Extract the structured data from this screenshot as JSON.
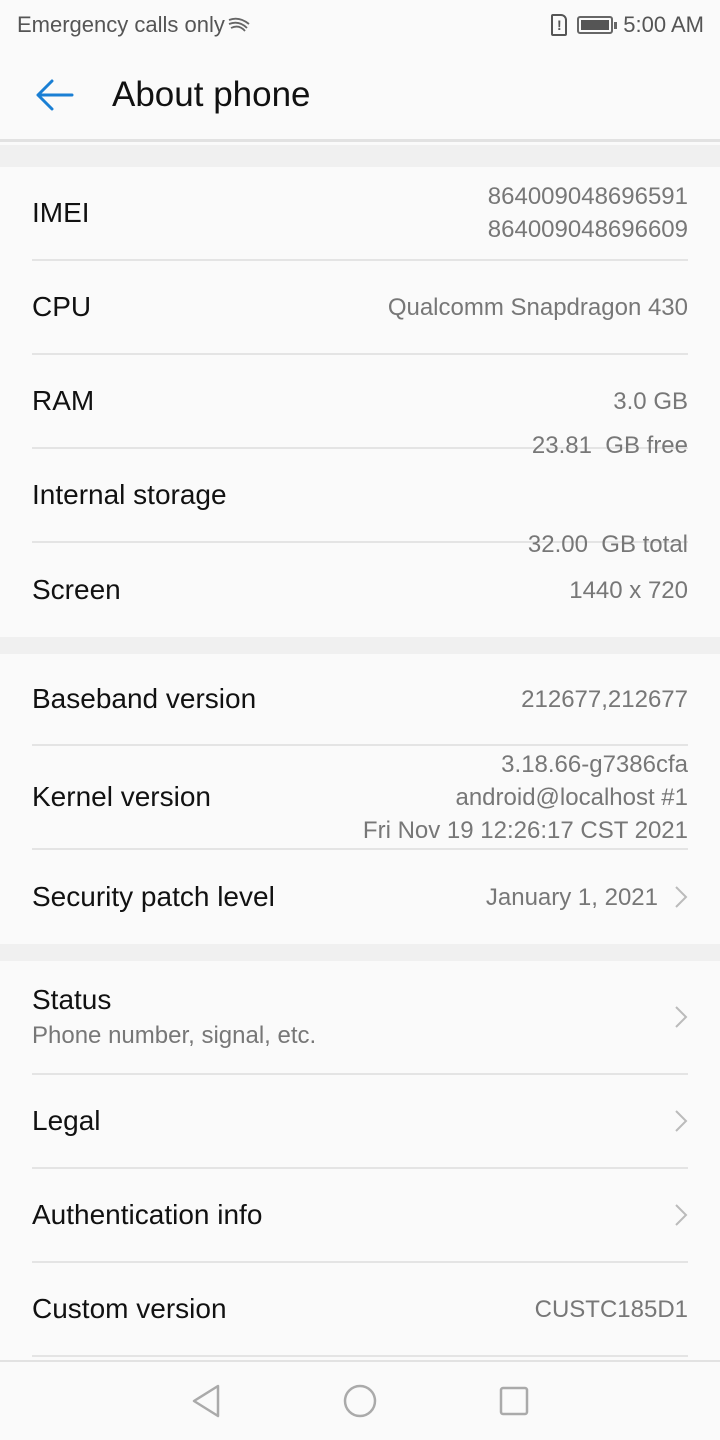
{
  "status_bar": {
    "carrier": "Emergency calls only",
    "time": "5:00 AM",
    "icons": [
      "swiftkey-icon",
      "sim-alert-icon",
      "battery-icon"
    ]
  },
  "header": {
    "title": "About phone",
    "back_icon": "arrow-left-icon"
  },
  "groups": [
    {
      "rows": [
        {
          "label": "IMEI",
          "values": [
            "864009048696591",
            "864009048696609"
          ]
        },
        {
          "label": "CPU",
          "values": [
            "Qualcomm Snapdragon 430"
          ]
        },
        {
          "label": "RAM",
          "values": [
            "3.0 GB"
          ]
        },
        {
          "label": "Internal storage",
          "values": [
            "23.81  GB free",
            "32.00  GB total"
          ]
        },
        {
          "label": "Screen",
          "values": [
            "1440 x 720"
          ]
        }
      ]
    },
    {
      "rows": [
        {
          "label": "Baseband version",
          "values": [
            "212677,212677"
          ]
        },
        {
          "label": "Kernel version",
          "values": [
            "3.18.66-g7386cfa",
            "android@localhost #1",
            "Fri Nov 19 12:26:17 CST 2021"
          ]
        },
        {
          "label": "Security patch level",
          "values": [
            "January 1, 2021"
          ],
          "chevron": true
        }
      ]
    },
    {
      "rows": [
        {
          "label": "Status",
          "subtitle": "Phone number, signal, etc.",
          "chevron": true
        },
        {
          "label": "Legal",
          "chevron": true
        },
        {
          "label": "Authentication info",
          "chevron": true
        },
        {
          "label": "Custom version",
          "values": [
            "CUSTC185D1"
          ]
        }
      ]
    }
  ],
  "nav_bar": {
    "buttons": [
      "back-icon",
      "home-icon",
      "recents-icon"
    ]
  },
  "colors": {
    "accent": "#1a7fd4",
    "text": "#111111",
    "secondary": "#777777"
  }
}
